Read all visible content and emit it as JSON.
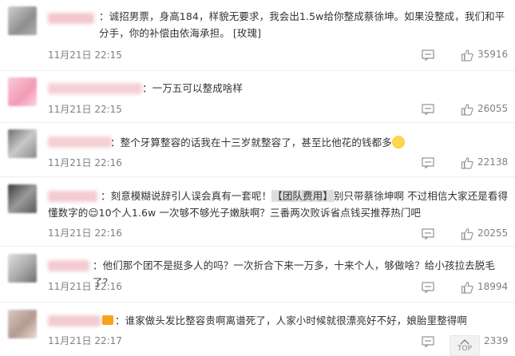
{
  "comments": [
    {
      "text": "诚招男票，身高184，样貌无要求，我会出1.5w给你整成蔡徐坤。如果没整成，我们和平分手，你的补偿由依海承担。",
      "emote": "[玫瑰]",
      "time": "11月21日 22:15",
      "likes": "35916"
    },
    {
      "text": "一万五可以整成啥样",
      "time": "11月21日 22:15",
      "likes": "26055"
    },
    {
      "text": "整个牙算整容的话我在十三岁就整容了，甚至比他花的钱都多",
      "time": "11月21日 22:16",
      "likes": "22138"
    },
    {
      "text_before": "刻意模糊说辞引人误会真有一套呢！",
      "tag": "【团队费用】",
      "text_after": "别只带蔡徐坤啊 不过相信大家还是看得懂数字的😌10个人1.6w 一次够不够光子嫩肤啊？三番两次败诉省点钱买推荐热门吧",
      "time": "11月21日 22:16",
      "likes": "20255"
    },
    {
      "text": "他们那个团不是挺多人的吗？一次折合下来一万多，十来个人，够做啥？给小孩拉去脱毛了？",
      "time": "11月21日 22:16",
      "likes": "18994"
    },
    {
      "text": "谁家做头发比整容贵啊离谱死了，人家小时候就很漂亮好不好，娘胎里整得啊",
      "time": "11月21日 22:17",
      "likes": "2339"
    }
  ],
  "back_to_top": "TOP",
  "icons": {
    "reply": "comment-icon",
    "like": "thumbs-up-icon"
  },
  "colors": {
    "time_text": "#808080",
    "body_text": "#333333"
  }
}
